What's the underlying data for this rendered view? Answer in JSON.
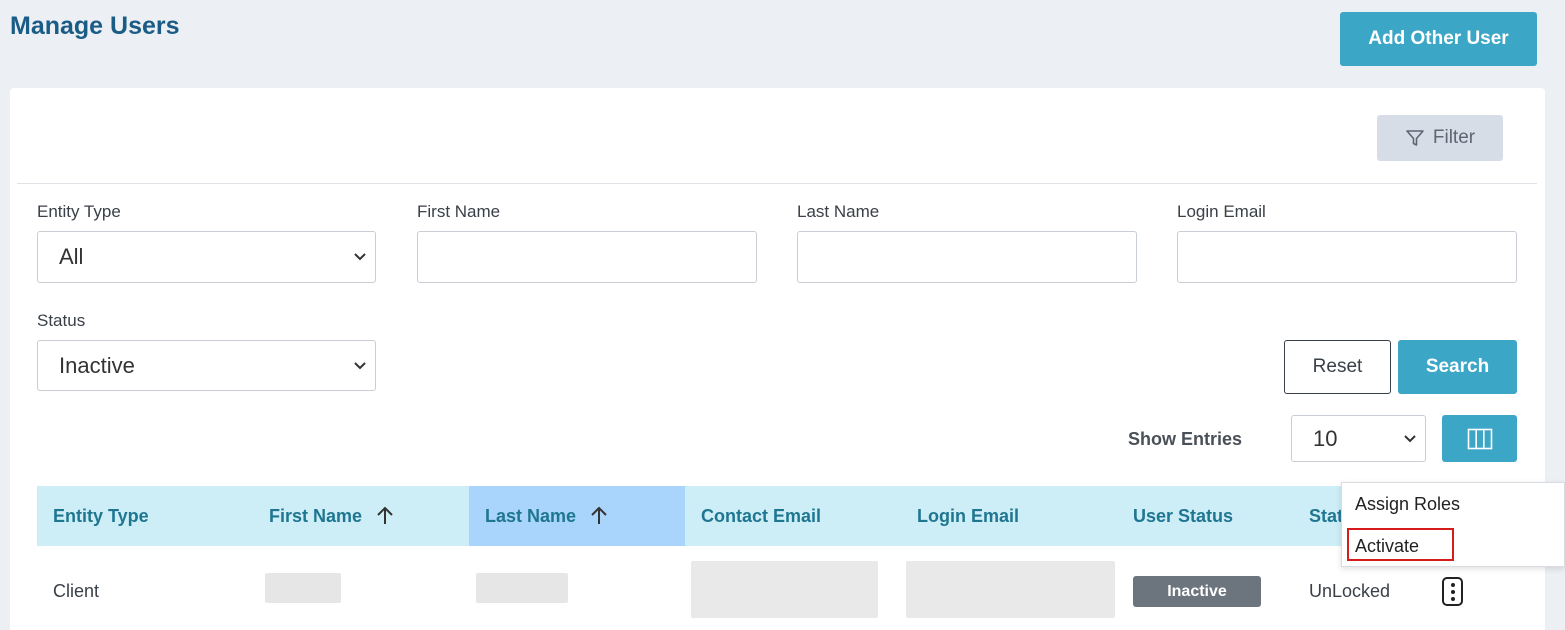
{
  "header": {
    "title": "Manage Users",
    "add_user_label": "Add Other User"
  },
  "filter": {
    "label": "Filter"
  },
  "form": {
    "entity_type": {
      "label": "Entity Type",
      "value": "All"
    },
    "first_name": {
      "label": "First Name",
      "value": ""
    },
    "last_name": {
      "label": "Last Name",
      "value": ""
    },
    "login_email": {
      "label": "Login Email",
      "value": ""
    },
    "status": {
      "label": "Status",
      "value": "Inactive"
    },
    "reset_label": "Reset",
    "search_label": "Search"
  },
  "entries": {
    "label": "Show Entries",
    "value": "10"
  },
  "table": {
    "columns": [
      "Entity Type",
      "First Name",
      "Last Name",
      "Contact Email",
      "Login Email",
      "User Status",
      "Stat"
    ],
    "sorted_column": "Last Name",
    "rows": [
      {
        "entity_type": "Client",
        "user_status": "Inactive",
        "lock_status": "UnLocked"
      }
    ]
  },
  "context_menu": {
    "items": [
      "Assign Roles",
      "Activate"
    ],
    "highlighted": "Activate"
  },
  "colors": {
    "accent": "#3ba6c6",
    "title": "#1b5c86",
    "header_bg": "#cdeef7",
    "sorted_header_bg": "#a9d4fb",
    "highlight_border": "#d61b1b"
  }
}
